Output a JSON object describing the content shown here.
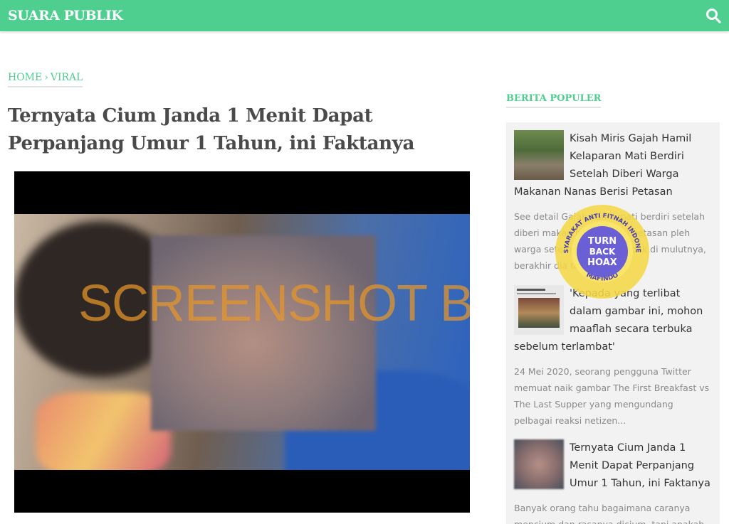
{
  "header": {
    "brand": "SUARA PUBLIK",
    "search_icon": "search-icon",
    "accent_color": "#4fcf8f"
  },
  "breadcrumb": {
    "home": "HOME",
    "separator": "›",
    "category": "VIRAL"
  },
  "article": {
    "title": "Ternyata Cium Janda 1 Menit Dapat Perpanjang Umur 1 Tahun, ini Faktanya",
    "video_watermark": "SCREENSHOT BY"
  },
  "badge": {
    "top_text": "MASYARAKAT ANTI FITNAH INDONESIA",
    "bottom_text": "MAFINDO",
    "line1": "TURN",
    "line2": "BACK",
    "line3": "HOAX"
  },
  "sidebar": {
    "heading": "BERITA POPULER",
    "items": [
      {
        "title": "Kisah Miris Gajah Hamil Kelaparan Mati Berdiri Setelah Diberi Warga Makanan Nanas Berisi Petasan",
        "desc": "See detail Gajah hamil mati berdiri setelah diberi makan nanas berisi petasan pleh warga setempat dan meledak di mulutnya, berakhir dia ta..."
      },
      {
        "title": "'Kepada yang terlibat dalam gambar ini, mohon maaflah secara terbuka sebelum terlambat'",
        "desc": "24 Mei 2020, seorang pengguna Twitter memuat naik gambar The First Breakfast vs The Last Supper yang mengundang pelbagai reaksi netizen..."
      },
      {
        "title": "Ternyata Cium Janda 1 Menit Dapat Perpanjang Umur 1 Tahun, ini Faktanya",
        "desc": "Banyak orang tahu bagaimana caranya mencium dan rasanya dicium, tapi apakah"
      }
    ]
  }
}
